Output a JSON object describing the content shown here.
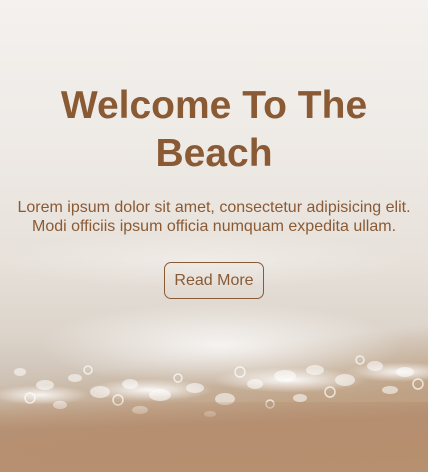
{
  "hero": {
    "title": "Welcome To The Beach",
    "description": "Lorem ipsum dolor sit amet, consectetur adipisicing elit. Modi officiis ipsum officia numquam expedita ullam.",
    "button_label": "Read More",
    "text_color": "#8a5a34",
    "background_image": "beach-waves-image"
  }
}
